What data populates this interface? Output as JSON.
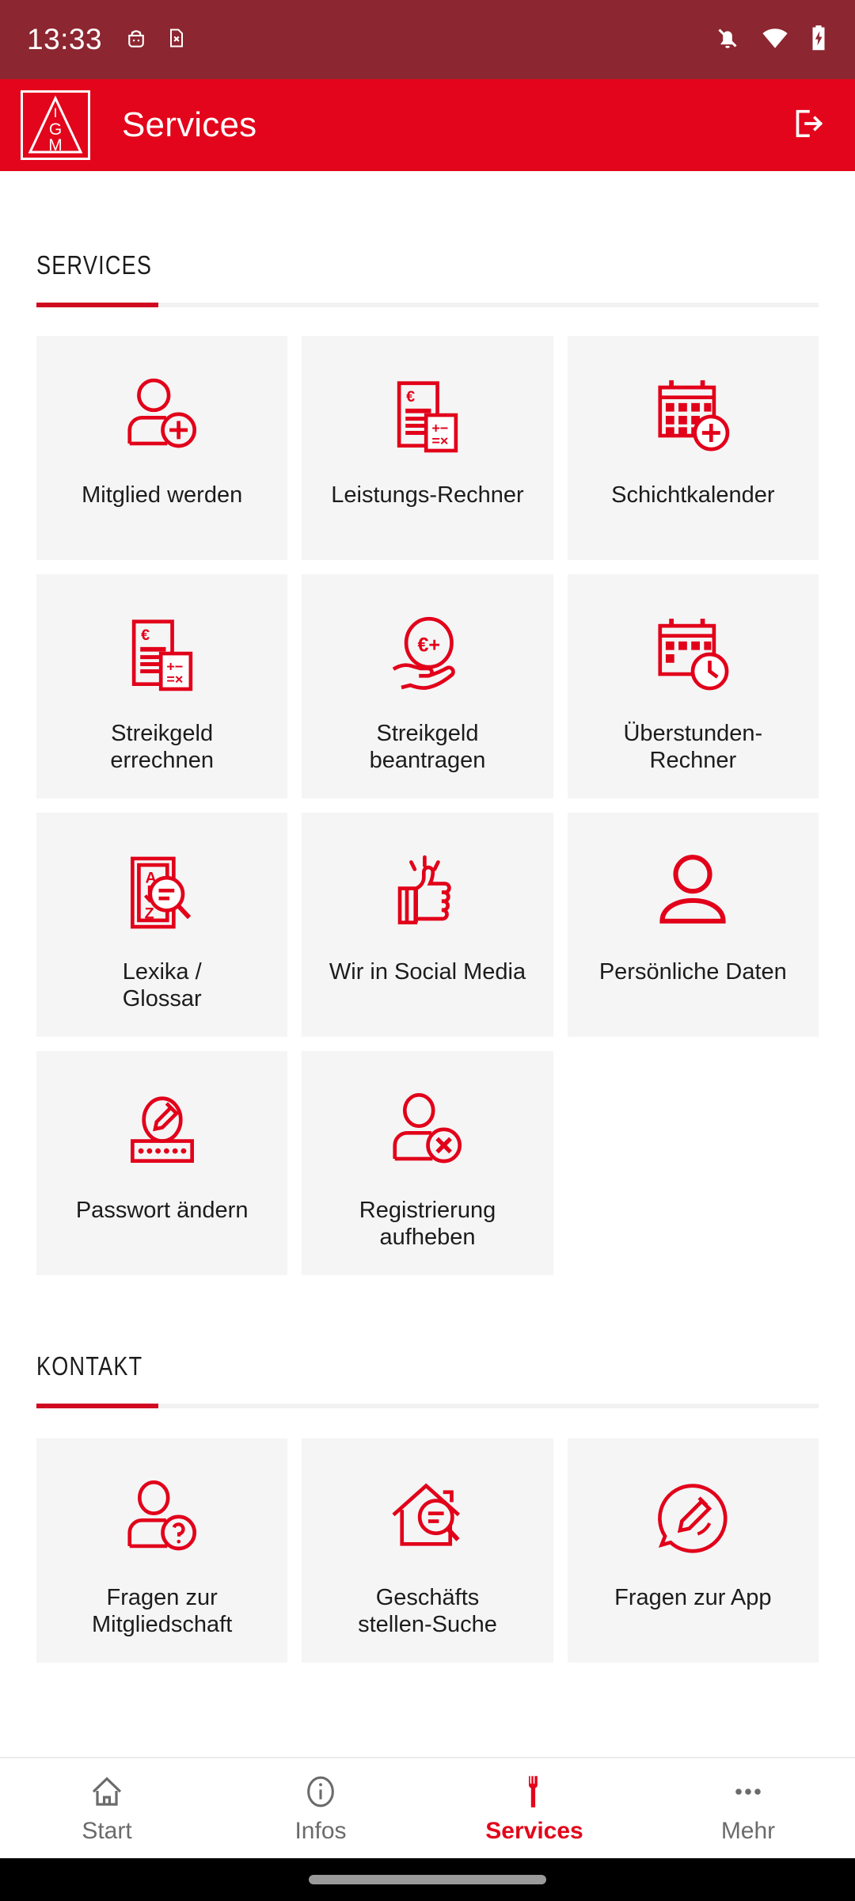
{
  "status_bar": {
    "time": "13:33",
    "left_icons": [
      "android-debug-icon",
      "sim-card-error-icon"
    ],
    "right_icons": [
      "notifications-off-icon",
      "wifi-icon",
      "battery-charging-icon"
    ],
    "background_color": "#8C2630"
  },
  "app_bar": {
    "logo": "ig-metall-logo",
    "title": "Services",
    "logout_icon": "logout-icon",
    "background_color": "#E3051B"
  },
  "sections": [
    {
      "id": "services",
      "title": "SERVICES",
      "accent_color": "#D00B21",
      "tiles": [
        {
          "label": "Mitglied werden",
          "icon": "user-add-icon"
        },
        {
          "label": "Leistungs-Rechner",
          "icon": "invoice-calculator-icon"
        },
        {
          "label": "Schichtkalender",
          "icon": "calendar-add-icon"
        },
        {
          "label": "Streikgeld\nerrechnen",
          "icon": "invoice-calculator-icon"
        },
        {
          "label": "Streikgeld\nbeantragen",
          "icon": "hand-euro-plus-icon"
        },
        {
          "label": "Überstunden-\nRechner",
          "icon": "calendar-clock-icon"
        },
        {
          "label": "Lexika /\nGlossar",
          "icon": "glossary-search-icon"
        },
        {
          "label": "Wir in Social Media",
          "icon": "thumbs-up-icon"
        },
        {
          "label": "Persönliche Daten",
          "icon": "user-icon"
        },
        {
          "label": "Passwort ändern",
          "icon": "password-edit-icon"
        },
        {
          "label": "Registrierung\naufheben",
          "icon": "user-remove-icon"
        }
      ]
    },
    {
      "id": "kontakt",
      "title": "KONTAKT",
      "accent_color": "#D00B21",
      "tiles": [
        {
          "label": "Fragen zur\nMitgliedschaft",
          "icon": "user-question-icon"
        },
        {
          "label": "Geschäfts\nstellen-Suche",
          "icon": "house-search-icon"
        },
        {
          "label": "Fragen zur App",
          "icon": "chat-edit-icon"
        }
      ]
    }
  ],
  "bottom_nav": {
    "items": [
      {
        "label": "Start",
        "icon": "home-icon",
        "active": false
      },
      {
        "label": "Infos",
        "icon": "info-icon",
        "active": false
      },
      {
        "label": "Services",
        "icon": "wrench-icon",
        "active": true
      },
      {
        "label": "Mehr",
        "icon": "more-dots-icon",
        "active": false
      }
    ],
    "active_color": "#E3051B",
    "inactive_color": "#6b6b6b"
  },
  "theme": {
    "brand_red": "#E3051B",
    "icon_red": "#E2001A",
    "tile_bg": "#F5F5F5",
    "text": "#1c1c1c"
  }
}
